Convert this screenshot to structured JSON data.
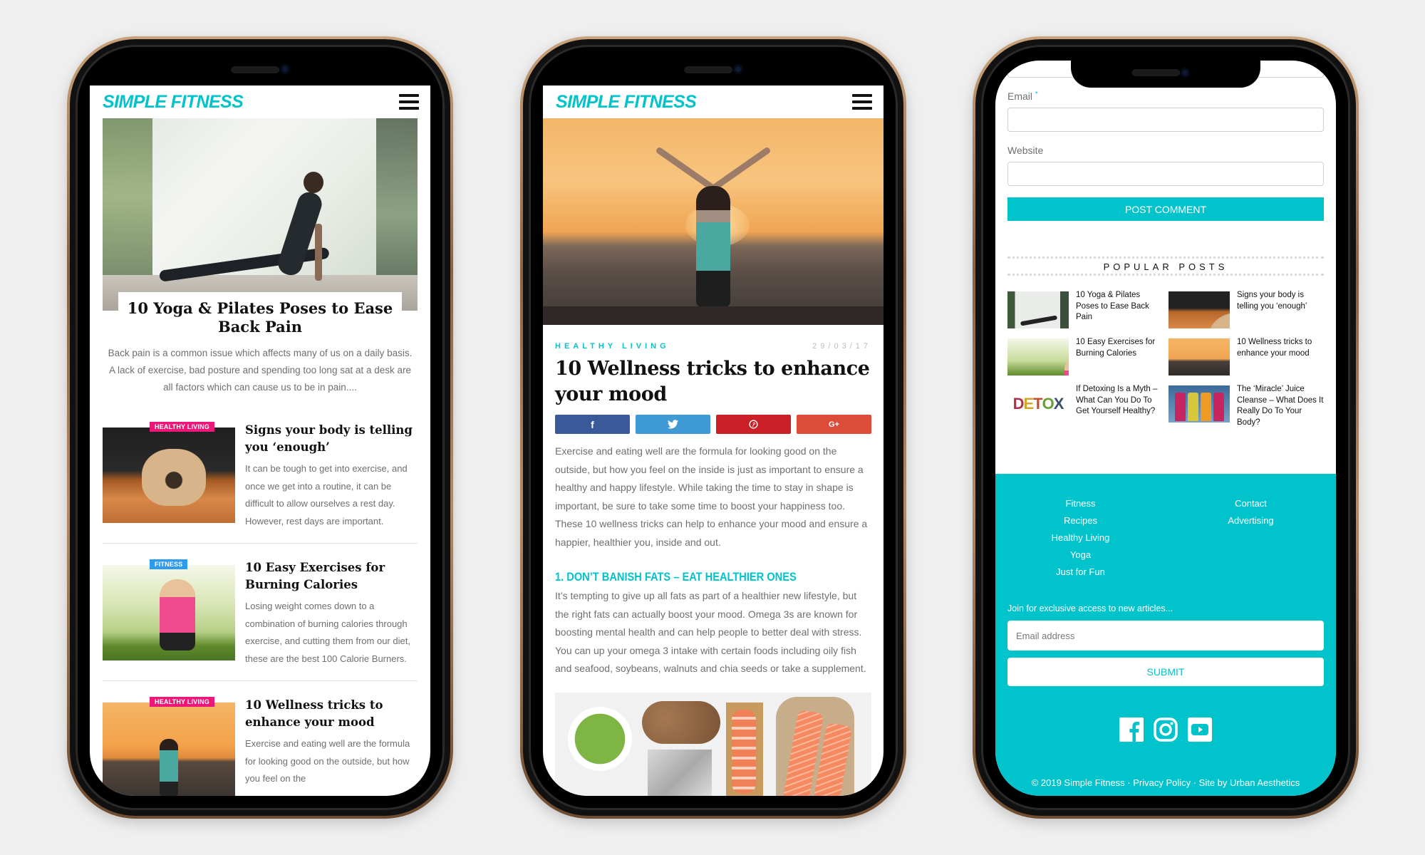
{
  "brand": {
    "logo": "SIMPLE FITNESS",
    "accent": "#00c3cc",
    "pink_badge": "#ec1779",
    "blue_badge": "#2d9cf0"
  },
  "phone1": {
    "featured": {
      "title": "10 Yoga & Pilates Poses to Ease Back Pain",
      "excerpt": "Back pain is a common issue which affects many of us on a daily basis. A lack of exercise, bad posture and spending too long sat at a desk are all factors which can cause us to be in pain...."
    },
    "posts": [
      {
        "badge": "HEALTHY LIVING",
        "title": "Signs your body is telling you ‘enough’",
        "excerpt": "It can be tough to get into exercise, and once we get into a routine, it can be difficult to allow ourselves a rest day. However, rest days are important."
      },
      {
        "badge": "FITNESS",
        "title": "10 Easy Exercises for Burning Calories",
        "excerpt": "Losing weight comes down to a combination of burning calories through exercise, and cutting them from our diet, these are the best 100 Calorie Burners."
      },
      {
        "badge": "HEALTHY LIVING",
        "title": "10 Wellness tricks to enhance your mood",
        "excerpt": "Exercise and eating well are the formula for looking good on the outside, but how you feel on the"
      }
    ]
  },
  "phone2": {
    "category": "HEALTHY LIVING",
    "date": "29/03/17",
    "title": "10 Wellness tricks to enhance your mood",
    "share": {
      "facebook": "f",
      "twitter": "twitter",
      "pinterest": "pinterest",
      "google_plus": "G+"
    },
    "intro": "Exercise and eating well are the formula for looking good on the outside, but how you feel on the inside is just as important to ensure a healthy and happy lifestyle. While taking the time to stay in shape is important, be sure to take some time to boost your happiness too. These 10 wellness tricks can help to enhance your mood and ensure a happier, healthier you, inside and out.",
    "section1_heading": "1. DON’T BANISH FATS – EAT HEALTHIER ONES",
    "section1_body": "It’s tempting to give up all fats as part of a healthier new lifestyle, but the right fats can actually boost your mood. Omega 3s are known for boosting mental health and can help people to better deal with stress. You can up your omega 3 intake with certain foods including oily fish and seafood, soybeans, walnuts and chia seeds or take a supplement."
  },
  "phone3": {
    "form": {
      "email_label": "Email",
      "required_mark": "*",
      "email_value": "",
      "website_label": "Website",
      "website_value": "",
      "post_comment": "POST COMMENT"
    },
    "popular": {
      "heading": "POPULAR POSTS",
      "items": [
        {
          "title": "10 Yoga & Pilates Poses to Ease Back Pain"
        },
        {
          "title": "Signs your body is telling you ‘enough’"
        },
        {
          "title": "10 Easy Exercises for Burning Calories"
        },
        {
          "title": "10 Wellness tricks to enhance your mood"
        },
        {
          "title": "If Detoxing Is a Myth – What Can You Do To Get Yourself Healthy?"
        },
        {
          "title": "The ‘Miracle’ Juice Cleanse – What Does It Really Do To Your Body?"
        }
      ],
      "detox_word": [
        "D",
        "E",
        "T",
        "O",
        "X"
      ]
    },
    "footer": {
      "links_col1": [
        "Fitness",
        "Recipes",
        "Healthy Living",
        "Yoga",
        "Just for Fun"
      ],
      "links_col2": [
        "Contact",
        "Advertising"
      ],
      "join_text": "Join for exclusive access to new articles...",
      "email_placeholder": "Email address",
      "submit": "SUBMIT",
      "socials": [
        "facebook-icon",
        "instagram-icon",
        "youtube-icon"
      ],
      "copyright": "© 2019 Simple Fitness · Privacy Policy · Site by Urban Aesthetics"
    }
  }
}
